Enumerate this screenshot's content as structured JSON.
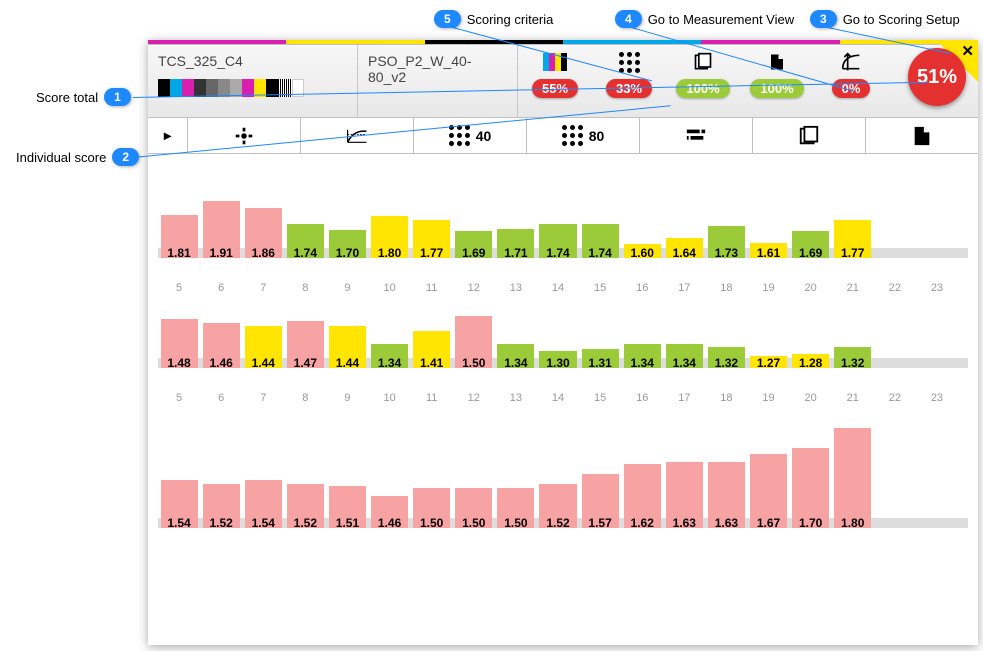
{
  "callouts": {
    "c1": {
      "num": "1",
      "label": "Score total"
    },
    "c2": {
      "num": "2",
      "label": "Individual score"
    },
    "c3": {
      "num": "3",
      "label": "Go to Scoring Setup"
    },
    "c4": {
      "num": "4",
      "label": "Go to Measurement View"
    },
    "c5": {
      "num": "5",
      "label": "Scoring criteria"
    }
  },
  "header": {
    "job_name": "TCS_325_C4",
    "profile_name": "PSO_P2_W_40-80_v2",
    "metrics": [
      {
        "icon": "cmyk",
        "pct": "55%",
        "color": "red"
      },
      {
        "icon": "dots",
        "pct": "33%",
        "color": "red"
      },
      {
        "icon": "stack",
        "pct": "100%",
        "color": "green"
      },
      {
        "icon": "page",
        "pct": "100%",
        "color": "green"
      },
      {
        "icon": "curve",
        "pct": "0%",
        "color": "red"
      }
    ],
    "total": "51%"
  },
  "tabs": [
    {
      "icon": "target",
      "label": ""
    },
    {
      "icon": "tvi",
      "label": ""
    },
    {
      "icon": "dots",
      "label": "40"
    },
    {
      "icon": "dots",
      "label": "80"
    },
    {
      "icon": "bars",
      "label": ""
    },
    {
      "icon": "stack",
      "label": ""
    },
    {
      "icon": "page",
      "label": ""
    }
  ],
  "chart_data": [
    {
      "type": "bar",
      "ylim": [
        1.5,
        2.0
      ],
      "series": [
        {
          "v": 1.81,
          "c": "r"
        },
        {
          "v": 1.91,
          "c": "r"
        },
        {
          "v": 1.86,
          "c": "r"
        },
        {
          "v": 1.74,
          "c": "g"
        },
        {
          "v": 1.7,
          "c": "g"
        },
        {
          "v": 1.8,
          "c": "y"
        },
        {
          "v": 1.77,
          "c": "y"
        },
        {
          "v": 1.69,
          "c": "g"
        },
        {
          "v": 1.71,
          "c": "g"
        },
        {
          "v": 1.74,
          "c": "g"
        },
        {
          "v": 1.74,
          "c": "g"
        },
        {
          "v": 1.6,
          "c": "y"
        },
        {
          "v": 1.64,
          "c": "y"
        },
        {
          "v": 1.73,
          "c": "g"
        },
        {
          "v": 1.61,
          "c": "y"
        },
        {
          "v": 1.69,
          "c": "g"
        },
        {
          "v": 1.77,
          "c": "y"
        }
      ],
      "xstart": 5,
      "xend": 23
    },
    {
      "type": "bar",
      "ylim": [
        1.2,
        1.6
      ],
      "series": [
        {
          "v": 1.48,
          "c": "r"
        },
        {
          "v": 1.46,
          "c": "r"
        },
        {
          "v": 1.44,
          "c": "y"
        },
        {
          "v": 1.47,
          "c": "r"
        },
        {
          "v": 1.44,
          "c": "y"
        },
        {
          "v": 1.34,
          "c": "g"
        },
        {
          "v": 1.41,
          "c": "y"
        },
        {
          "v": 1.5,
          "c": "r"
        },
        {
          "v": 1.34,
          "c": "g"
        },
        {
          "v": 1.3,
          "c": "g"
        },
        {
          "v": 1.31,
          "c": "g"
        },
        {
          "v": 1.34,
          "c": "g"
        },
        {
          "v": 1.34,
          "c": "g"
        },
        {
          "v": 1.32,
          "c": "g"
        },
        {
          "v": 1.27,
          "c": "y"
        },
        {
          "v": 1.28,
          "c": "y"
        },
        {
          "v": 1.32,
          "c": "g"
        }
      ],
      "xstart": 5,
      "xend": 23
    },
    {
      "type": "bar",
      "ylim": [
        1.3,
        1.9
      ],
      "series": [
        {
          "v": 1.54,
          "c": "r"
        },
        {
          "v": 1.52,
          "c": "r"
        },
        {
          "v": 1.54,
          "c": "r"
        },
        {
          "v": 1.52,
          "c": "r"
        },
        {
          "v": 1.51,
          "c": "r"
        },
        {
          "v": 1.46,
          "c": "r"
        },
        {
          "v": 1.5,
          "c": "r"
        },
        {
          "v": 1.5,
          "c": "r"
        },
        {
          "v": 1.5,
          "c": "r"
        },
        {
          "v": 1.52,
          "c": "r"
        },
        {
          "v": 1.57,
          "c": "r"
        },
        {
          "v": 1.62,
          "c": "r"
        },
        {
          "v": 1.63,
          "c": "r"
        },
        {
          "v": 1.63,
          "c": "r"
        },
        {
          "v": 1.67,
          "c": "r"
        },
        {
          "v": 1.7,
          "c": "r"
        },
        {
          "v": 1.8,
          "c": "r"
        }
      ],
      "xstart": 5,
      "xend": 23
    }
  ],
  "colors": {
    "rainbow": [
      "#d91eb0",
      "#ffe500",
      "#000",
      "#00a8e8",
      "#d91eb0",
      "#ffe500"
    ]
  }
}
